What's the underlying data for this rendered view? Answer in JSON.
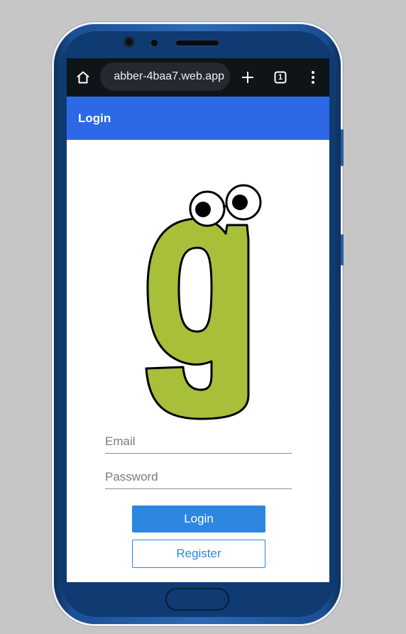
{
  "browser": {
    "url": "abber-4baa7.web.app",
    "tab_count": "1",
    "icons": {
      "home": "home-icon",
      "new_tab": "plus-icon",
      "tabs": "tab-switcher-icon",
      "menu": "kebab-menu-icon"
    }
  },
  "app_bar": {
    "title": "Login"
  },
  "form": {
    "email": {
      "placeholder": "Email",
      "value": ""
    },
    "password": {
      "placeholder": "Password",
      "value": ""
    },
    "login_label": "Login",
    "register_label": "Register"
  },
  "colors": {
    "app_bar": "#2d69e6",
    "primary_button": "#2d86e0",
    "logo_green": "#a8bf3a",
    "browser_bar": "#0e1418"
  }
}
